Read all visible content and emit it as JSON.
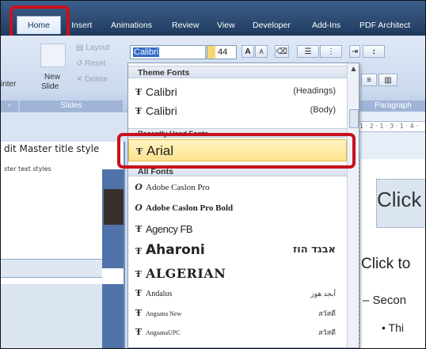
{
  "tabs": [
    {
      "label": "Home"
    },
    {
      "label": "Insert"
    },
    {
      "label": "Animations"
    },
    {
      "label": "Review"
    },
    {
      "label": "View"
    },
    {
      "label": "Developer"
    },
    {
      "label": "Add-Ins"
    },
    {
      "label": "PDF Architect"
    }
  ],
  "ribbon": {
    "layout": "Layout",
    "reset": "Reset",
    "delete": "Delete",
    "new": "New",
    "slide": "Slide",
    "painter": "inter",
    "slides_group": "Slides",
    "paragraph_group": "Paragraph",
    "font_name": "Calibri",
    "font_size": "44",
    "grow": "A",
    "shrink": "A"
  },
  "dropdown": {
    "theme_header": "Theme Fonts",
    "theme_fonts": [
      {
        "name": "Calibri",
        "role": "(Headings)"
      },
      {
        "name": "Calibri",
        "role": "(Body)"
      }
    ],
    "recent_header": "Recently Used Fonts",
    "recent_fonts": [
      {
        "name": "Arial"
      }
    ],
    "all_header": "All Fonts",
    "all_fonts": [
      {
        "name": "Adobe Caslon Pro",
        "sample": ""
      },
      {
        "name": "Adobe Caslon Pro Bold",
        "sample": ""
      },
      {
        "name": "Agency FB",
        "sample": ""
      },
      {
        "name": "Aharoni",
        "sample": "אבגד הוז"
      },
      {
        "name": "ALGERIAN",
        "sample": ""
      },
      {
        "name": "Andalus",
        "sample": "أبجد هوز"
      },
      {
        "name": "Angsana New",
        "sample": "สวัสดี"
      },
      {
        "name": "AngsanaUPC",
        "sample": "สวัสดี"
      }
    ]
  },
  "left_pane": {
    "title_text": "dit Master title style",
    "body_text": "ster text styles"
  },
  "slide": {
    "click_title": "Click",
    "click_text": "Click to",
    "second_level": "– Secon",
    "third_level": "• Thi"
  },
  "ruler_text": "1 · 2 · 1 · 3 · 1 · 4 ·"
}
